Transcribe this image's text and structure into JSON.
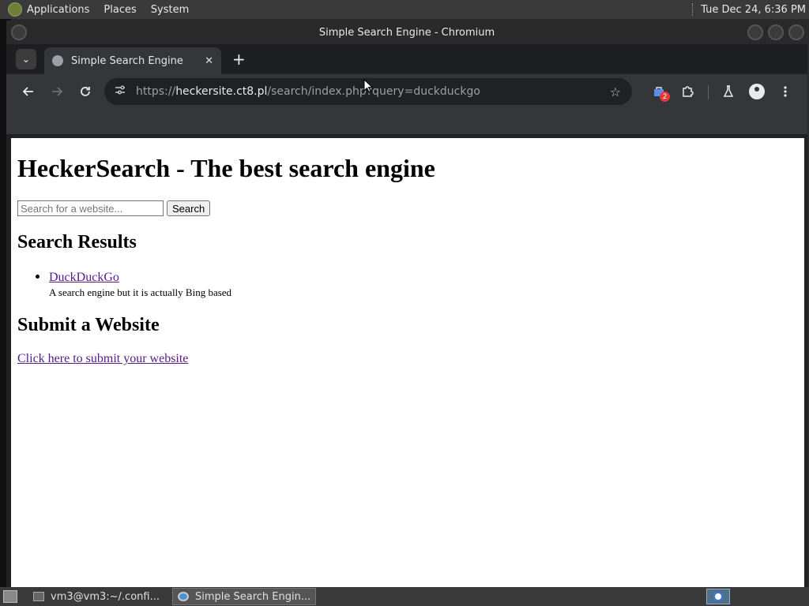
{
  "top_panel": {
    "menus": [
      "Applications",
      "Places",
      "System"
    ],
    "clock": "Tue Dec 24,  6:36 PM"
  },
  "window": {
    "title": "Simple Search Engine - Chromium"
  },
  "tab": {
    "title": "Simple Search Engine",
    "close": "✕"
  },
  "toolbar": {
    "url_scheme": "https://",
    "url_host": "heckersite.ct8.pl",
    "url_path": "/search/index.php?query=duckduckgo",
    "extension_badge": "2"
  },
  "page": {
    "heading": "HeckerSearch - The best search engine",
    "search_placeholder": "Search for a website...",
    "search_button": "Search",
    "results_heading": "Search Results",
    "results": [
      {
        "title": "DuckDuckGo",
        "description": "A search engine but it is actually Bing based"
      }
    ],
    "submit_heading": "Submit a Website",
    "submit_link": "Click here to submit your website"
  },
  "taskbar": {
    "tasks": [
      {
        "label": "vm3@vm3:~/.confi..."
      },
      {
        "label": "Simple Search Engin..."
      }
    ]
  },
  "colors": {
    "link_visited": "#551a8b",
    "chrome_toolbar": "#35363a",
    "chrome_tabstrip": "#1e1f22"
  }
}
